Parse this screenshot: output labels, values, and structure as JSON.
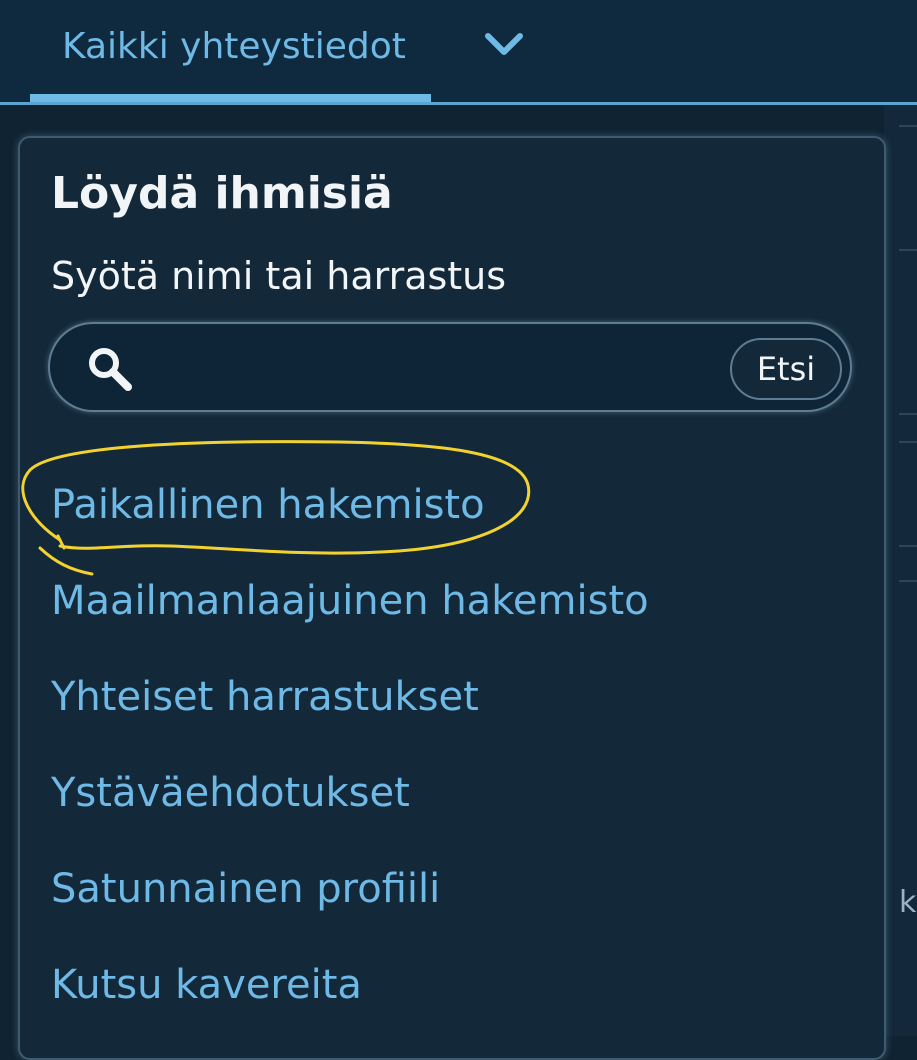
{
  "tabs": {
    "active_label": "Kaikki yhteystiedot"
  },
  "background_fragment": "ki",
  "panel": {
    "title": "Löydä ihmisiä",
    "subtitle": "Syötä nimi tai harrastus",
    "search": {
      "value": "",
      "placeholder": "",
      "button_label": "Etsi"
    },
    "links": [
      {
        "label": "Paikallinen hakemisto"
      },
      {
        "label": "Maailmanlaajuinen hakemisto"
      },
      {
        "label": "Yhteiset harrastukset"
      },
      {
        "label": "Ystäväehdotukset"
      },
      {
        "label": "Satunnainen profiili"
      },
      {
        "label": "Kutsu kavereita"
      }
    ]
  },
  "annotation": {
    "highlight_color": "#f2d230",
    "highlighted_item": "Paikallinen hakemisto"
  },
  "colors": {
    "accent": "#6fb9e6",
    "background": "#0f2332",
    "panel": "#13293a",
    "text": "#f2f5f7"
  },
  "icons": {
    "dropdown": "chevron-down-icon",
    "search": "search-icon"
  }
}
